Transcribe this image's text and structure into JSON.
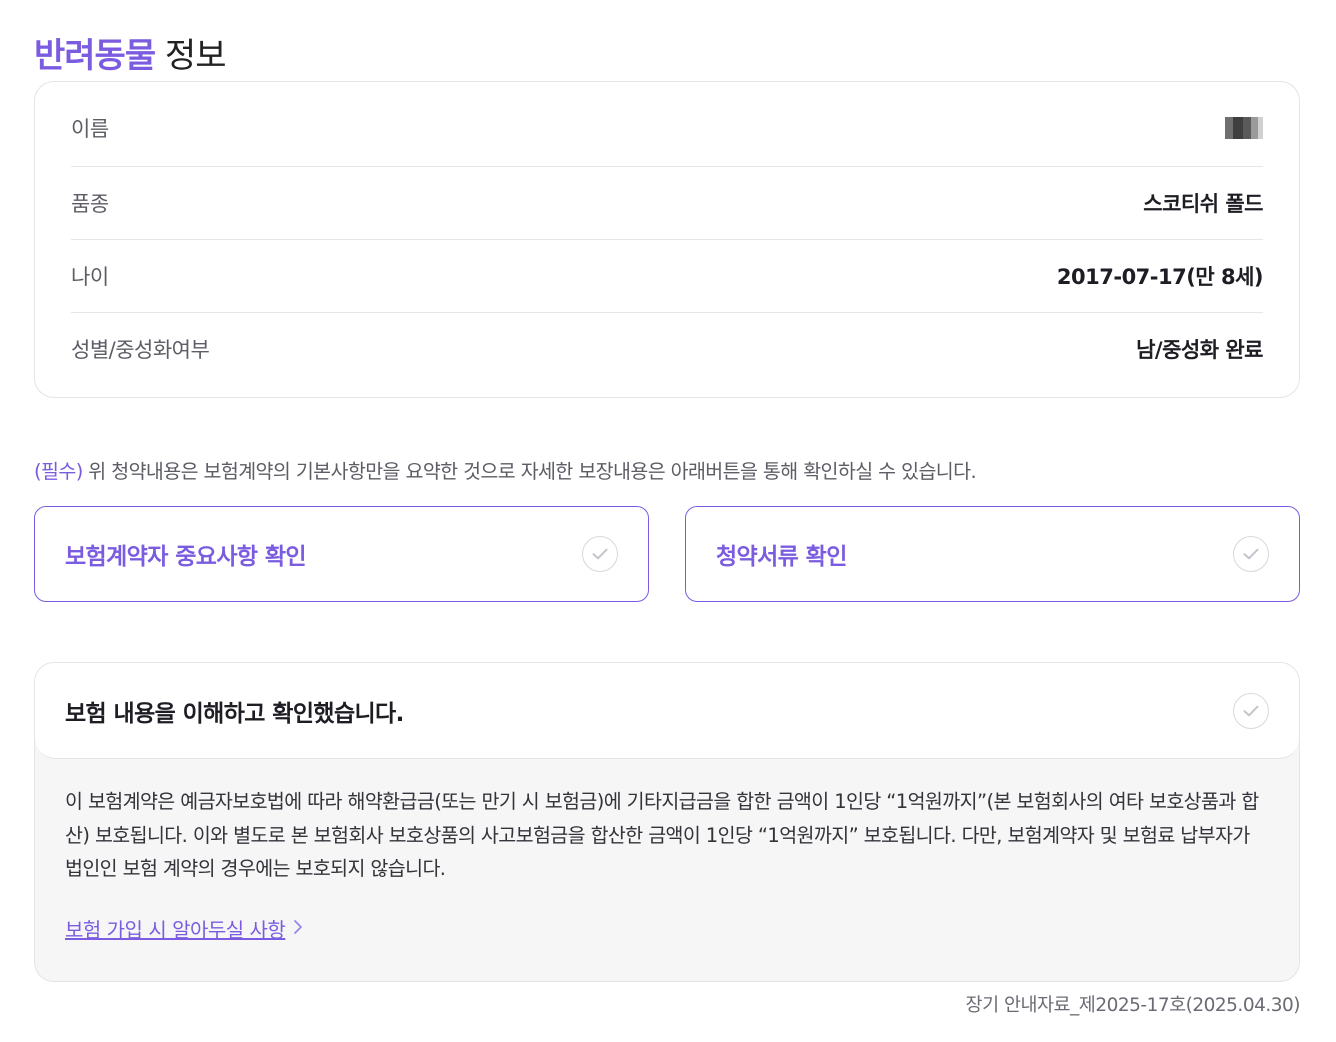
{
  "header": {
    "title_accent": "반려동물",
    "title_rest": " 정보"
  },
  "pet_info": {
    "rows": [
      {
        "label": "이름",
        "value": ""
      },
      {
        "label": "품종",
        "value": "스코티쉬 폴드"
      },
      {
        "label": "나이",
        "value": "2017-07-17(만 8세)"
      },
      {
        "label": "성별/중성화여부",
        "value": "남/중성화 완료"
      }
    ]
  },
  "notice": {
    "required": "(필수)",
    "text": " 위 청약내용은 보험계약의 기본사항만을 요약한 것으로 자세한 보장내용은 아래버튼을 통해 확인하실 수 있습니다."
  },
  "buttons": {
    "important_items": "보험계약자 중요사항 확인",
    "documents": "청약서류 확인"
  },
  "acknowledge": {
    "label": "보험 내용을 이해하고 확인했습니다.",
    "body": "이 보험계약은 예금자보호법에 따라 해약환급금(또는 만기 시 보험금)에 기타지급금을 합한 금액이 1인당 “1억원까지”(본 보험회사의 여타 보호상품과 합산) 보호됩니다. 이와 별도로 본 보험회사 보호상품의 사고보험금을 합산한 금액이 1인당 “1억원까지” 보호됩니다. 다만, 보험계약자 및 보험료 납부자가 법인인 보험 계약의 경우에는 보호되지 않습니다.",
    "link": "보험 가입 시 알아두실 사항"
  },
  "footnote": "장기 안내자료_제2025-17호(2025.04.30)",
  "colors": {
    "accent": "#7b5ce0",
    "check_border": "#d8d8de",
    "check_mark": "#c4c4cc"
  }
}
